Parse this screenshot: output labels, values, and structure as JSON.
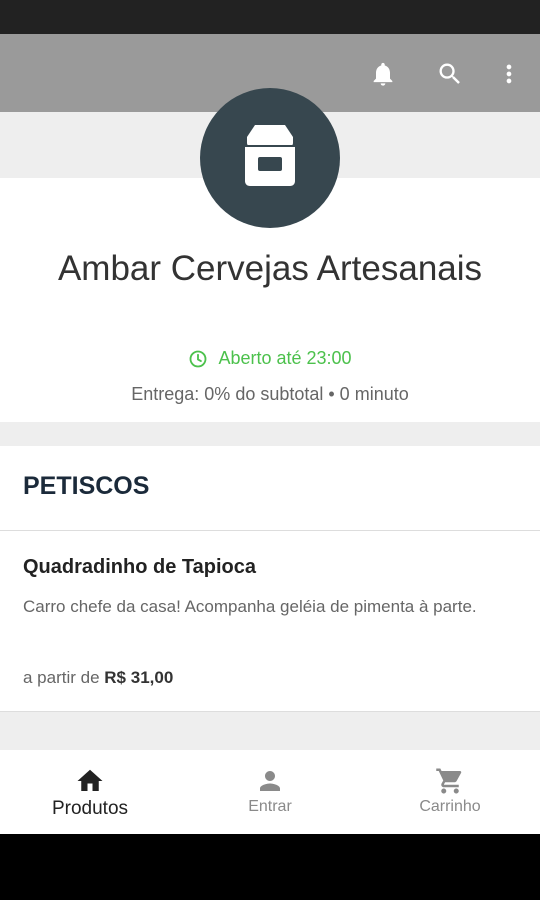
{
  "store": {
    "name": "Ambar Cervejas Artesanais",
    "open_status": "Aberto até 23:00",
    "delivery_info": "Entrega: 0% do subtotal • 0 minuto"
  },
  "section": {
    "title": "PETISCOS"
  },
  "product": {
    "name": "Quadradinho de Tapioca",
    "description": "Carro chefe da casa! Acompanha geléia de pimenta à parte.",
    "price_prefix": "a partir de",
    "price": "R$ 31,00"
  },
  "nav": {
    "items": [
      {
        "label": "Produtos",
        "icon": "home-icon",
        "active": true
      },
      {
        "label": "Entrar",
        "icon": "person-icon",
        "active": false
      },
      {
        "label": "Carrinho",
        "icon": "cart-icon",
        "active": false
      }
    ]
  },
  "colors": {
    "app_bar": "#9a9a9a",
    "logo_bg": "#37474f",
    "open_green": "#4cc14c"
  }
}
